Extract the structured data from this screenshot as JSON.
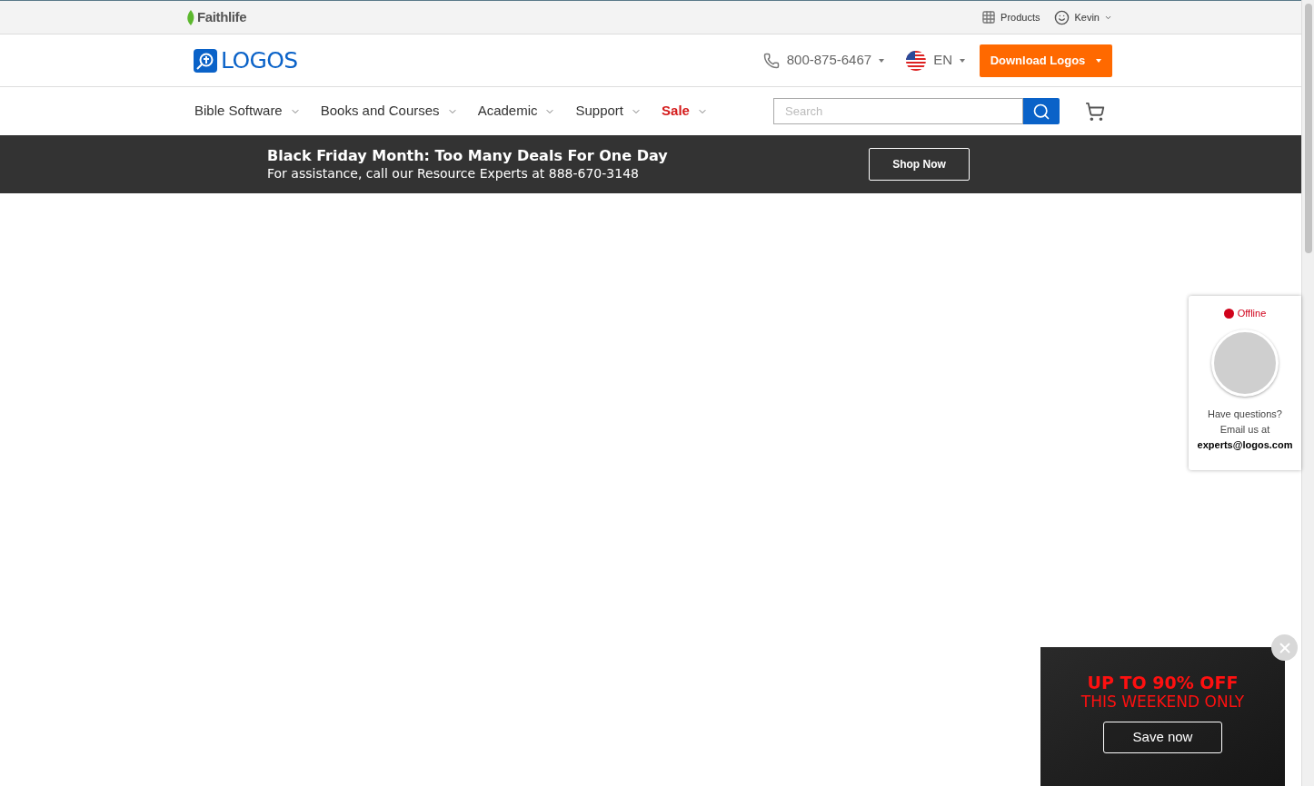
{
  "top_bar": {
    "brand": "Faithlife",
    "links": [
      {
        "kind": "grid",
        "label": "Products"
      },
      {
        "kind": "user",
        "label": "Kevin"
      }
    ]
  },
  "header": {
    "logo": "LOGOS",
    "phone": "800-875-6467",
    "language": "EN",
    "download_button": "Download Logos"
  },
  "nav": {
    "items": [
      {
        "label": "Bible Software",
        "highlighted": false
      },
      {
        "label": "Books and Courses",
        "highlighted": false
      },
      {
        "label": "Academic",
        "highlighted": false
      },
      {
        "label": "Support",
        "highlighted": false
      },
      {
        "label": "Sale",
        "highlighted": true
      }
    ],
    "search": {
      "placeholder": "Search"
    }
  },
  "banner": {
    "title": "Black Friday Month: Too Many Deals For One Day",
    "subtitle": "For assistance, call our Resource Experts at 888-670-3148",
    "button": "Shop Now"
  },
  "chat_widget": {
    "status": "Offline",
    "online": false,
    "lines": [
      "Have questions?",
      "Email us at"
    ],
    "email": "experts@logos.com"
  },
  "promo": {
    "headline": "UP TO 90% OFF",
    "subline": "THIS WEEKEND ONLY",
    "button": "Save now"
  }
}
